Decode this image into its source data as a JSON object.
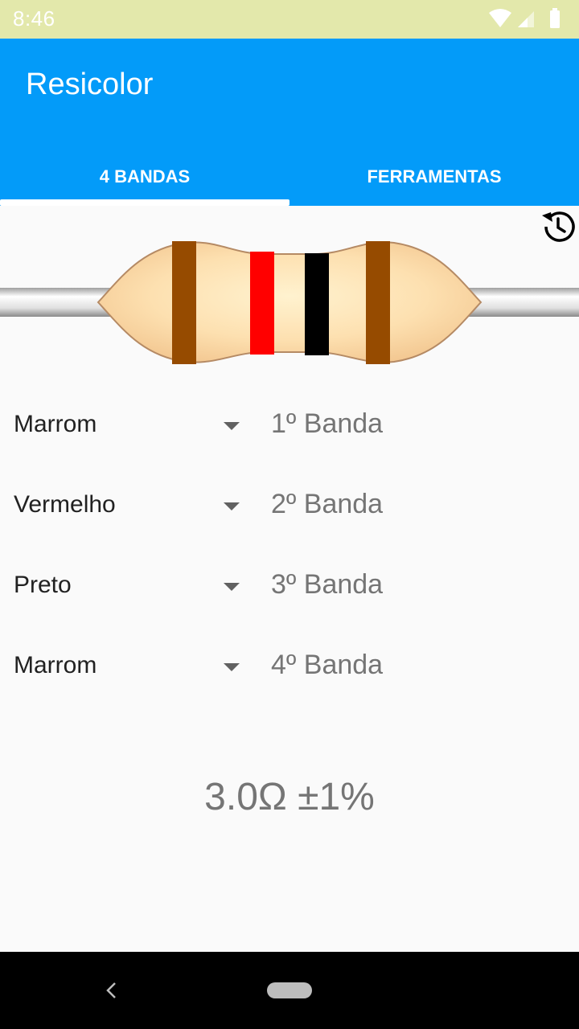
{
  "status_bar": {
    "time": "8:46",
    "icons": [
      "wifi-icon",
      "cell-signal-icon",
      "battery-icon"
    ]
  },
  "app": {
    "title": "Resicolor"
  },
  "tabs": [
    {
      "label": "4 BANDAS",
      "selected": true
    },
    {
      "label": "FERRAMENTAS",
      "selected": false
    }
  ],
  "history": {
    "icon": "history-icon"
  },
  "resistor": {
    "band_colors": [
      "#964b00",
      "#ff0000",
      "#000000",
      "#964b00"
    ]
  },
  "bands": [
    {
      "color": "Marrom",
      "label": "1º Banda"
    },
    {
      "color": "Vermelho",
      "label": "2º Banda"
    },
    {
      "color": "Preto",
      "label": "3º Banda"
    },
    {
      "color": "Marrom",
      "label": "4º Banda"
    }
  ],
  "result": {
    "text": "3.0Ω ±1%"
  },
  "colors": {
    "accent": "#039bf9",
    "status_bar": "#e3e8ab"
  },
  "nav": {
    "icons": [
      "back-icon",
      "home-pill-icon"
    ]
  }
}
